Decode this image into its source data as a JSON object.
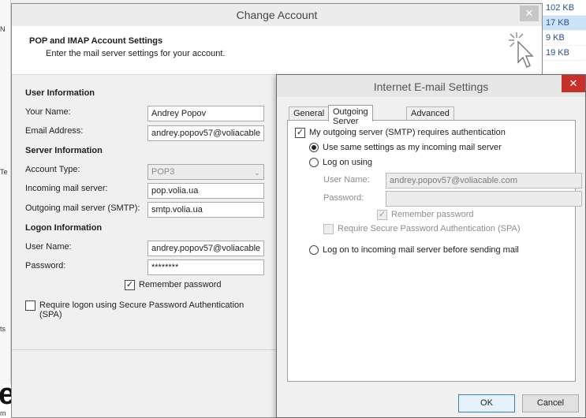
{
  "background": {
    "left_fragments": [
      "N",
      "Te",
      "ts"
    ],
    "file_sizes": [
      "102 KB",
      "17 KB",
      "9 KB",
      "19 KB"
    ],
    "selected_index": 1,
    "brand_text": "ega",
    "brand_sub": "m"
  },
  "change_account": {
    "title": "Change Account",
    "close_label": "✕",
    "header_title": "POP and IMAP Account Settings",
    "header_subtitle": "Enter the mail server settings for your account.",
    "user_info": {
      "section": "User Information",
      "name_label": "Your Name:",
      "name_value": "Andrey Popov",
      "email_label": "Email Address:",
      "email_value": "andrey.popov57@voliacable"
    },
    "server_info": {
      "section": "Server Information",
      "account_type_label": "Account Type:",
      "account_type_value": "POP3",
      "incoming_label": "Incoming mail server:",
      "incoming_value": "pop.volia.ua",
      "outgoing_label": "Outgoing mail server (SMTP):",
      "outgoing_value": "smtp.volia.ua"
    },
    "logon_info": {
      "section": "Logon Information",
      "username_label": "User Name:",
      "username_value": "andrey.popov57@voliacable",
      "password_label": "Password:",
      "password_value": "********",
      "remember_label": "Remember password",
      "remember_checked": true,
      "spa_label": "Require logon using Secure Password Authentication (SPA)",
      "spa_checked": false
    }
  },
  "internet_settings": {
    "title": "Internet E-mail Settings",
    "close_label": "✕",
    "tabs": [
      {
        "label": "General",
        "active": false
      },
      {
        "label": "Outgoing Server",
        "active": true
      },
      {
        "label": "Advanced",
        "active": false
      }
    ],
    "smtp_auth_label": "My outgoing server (SMTP) requires authentication",
    "smtp_auth_checked": true,
    "same_settings_label": "Use same settings as my incoming mail server",
    "logon_using_label": "Log on using",
    "username_label": "User Name:",
    "username_value": "andrey.popov57@voliacable.com",
    "password_label": "Password:",
    "password_value": "",
    "remember_label": "Remember password",
    "spa_label": "Require Secure Password Authentication (SPA)",
    "incoming_first_label": "Log on to incoming mail server before sending mail",
    "selected_option": "same_settings",
    "ok_label": "OK",
    "cancel_label": "Cancel"
  }
}
